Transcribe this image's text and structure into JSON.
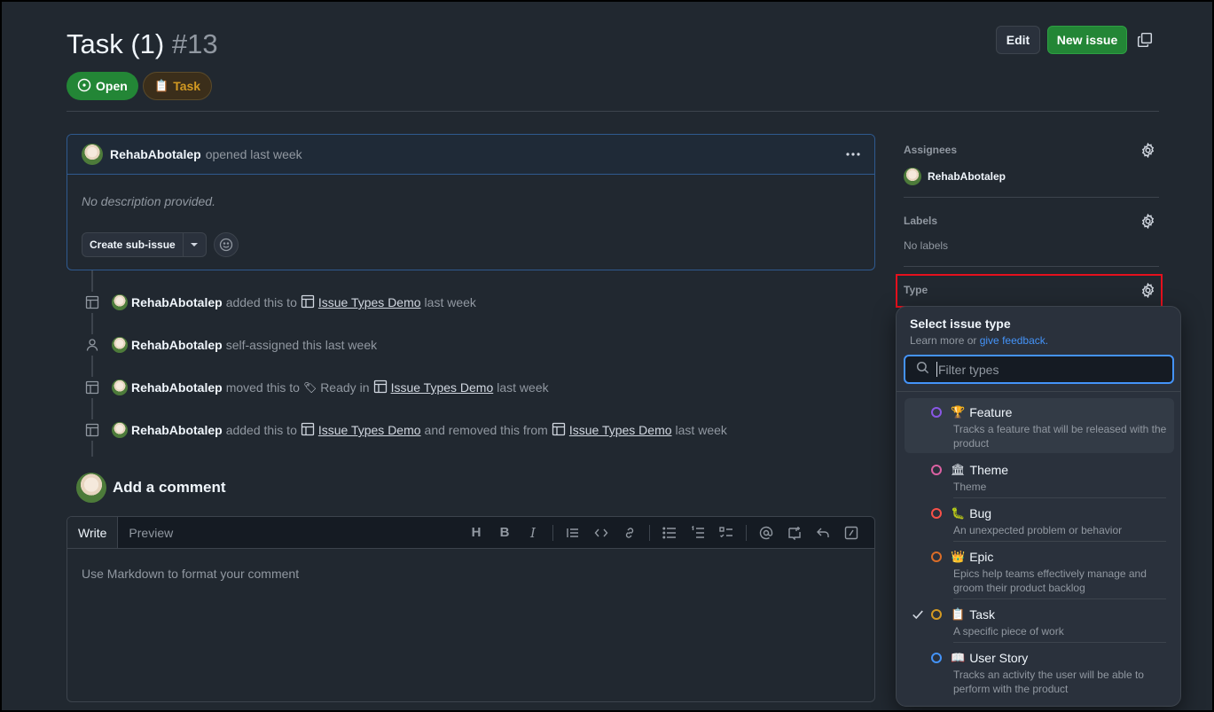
{
  "issue": {
    "title": "Task (1)",
    "number": "#13",
    "state_label": "Open",
    "type_label": "Task",
    "type_emoji": "📋"
  },
  "header": {
    "edit_label": "Edit",
    "new_issue_label": "New issue"
  },
  "body": {
    "author": "RehabAbotalep",
    "opened_text": "opened last week",
    "description": "No description provided.",
    "create_sub_issue_label": "Create sub-issue"
  },
  "timeline": [
    {
      "actor": "RehabAbotalep",
      "pre": "added this to",
      "link1": "Issue Types Demo",
      "mid": "",
      "link2": "",
      "post": "last week",
      "icon": "table-icon"
    },
    {
      "actor": "RehabAbotalep",
      "pre": "self-assigned this last week",
      "link1": "",
      "mid": "",
      "link2": "",
      "post": "",
      "icon": "person-icon"
    },
    {
      "actor": "RehabAbotalep",
      "pre": "moved this to",
      "status": "Ready",
      "in": "in",
      "link1": "Issue Types Demo",
      "post": "last week",
      "icon": "table-icon"
    },
    {
      "actor": "RehabAbotalep",
      "pre": "added this to",
      "link1": "Issue Types Demo",
      "mid": "and removed this from",
      "link2": "Issue Types Demo",
      "post": "last week",
      "icon": "table-icon"
    }
  ],
  "comment": {
    "heading": "Add a comment",
    "tab_write": "Write",
    "tab_preview": "Preview",
    "placeholder": "Use Markdown to format your comment"
  },
  "sidebar": {
    "assignees_label": "Assignees",
    "assignee": "RehabAbotalep",
    "labels_label": "Labels",
    "labels_value": "No labels",
    "type_label": "Type"
  },
  "type_menu": {
    "title": "Select issue type",
    "subtitle_prefix": "Learn more or",
    "subtitle_link": "give feedback.",
    "filter_placeholder": "Filter types",
    "items": [
      {
        "emoji": "🏆",
        "name": "Feature",
        "desc": "Tracks a feature that will be released with the product",
        "color": "#8957e5",
        "selected": false
      },
      {
        "emoji": "🏛",
        "name": "Theme",
        "desc": "Theme",
        "color": "#db61a2",
        "selected": false
      },
      {
        "emoji": "🐛",
        "name": "Bug",
        "desc": "An unexpected problem or behavior",
        "color": "#f85149",
        "selected": false
      },
      {
        "emoji": "👑",
        "name": "Epic",
        "desc": "Epics help teams effectively manage and groom their product backlog",
        "color": "#db6d28",
        "selected": false
      },
      {
        "emoji": "📋",
        "name": "Task",
        "desc": "A specific piece of work",
        "color": "#d29922",
        "selected": true
      },
      {
        "emoji": "📖",
        "name": "User Story",
        "desc": "Tracks an activity the user will be able to perform with the product",
        "color": "#4493f8",
        "selected": false
      }
    ]
  },
  "colors": {
    "accent_green": "#238636",
    "link_blue": "#4493f8",
    "highlight_red": "#e5101d"
  }
}
